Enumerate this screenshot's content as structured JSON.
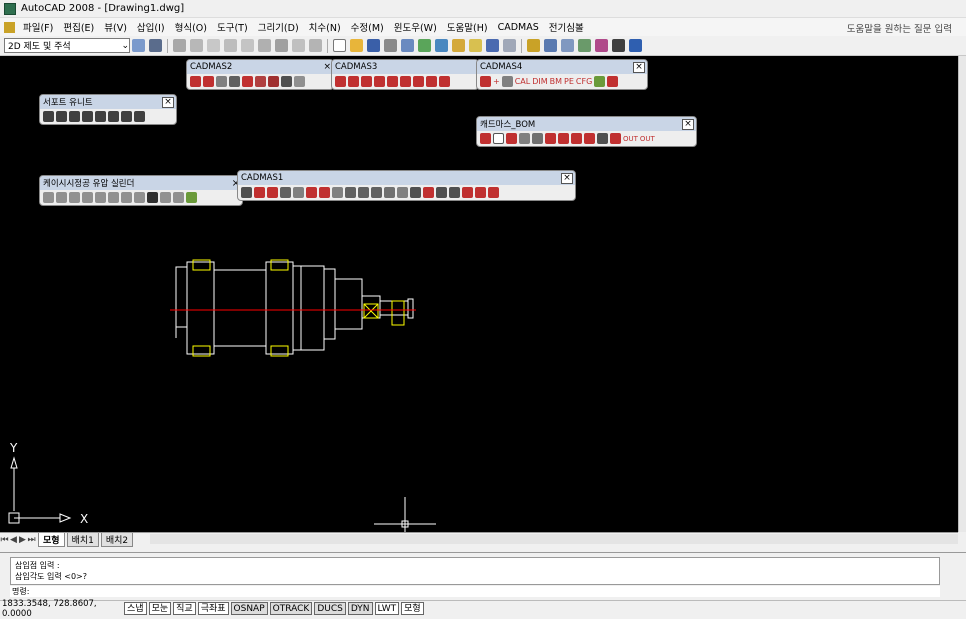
{
  "window": {
    "title": "AutoCAD 2008 - [Drawing1.dwg]"
  },
  "menu": {
    "items": [
      "파일(F)",
      "편집(E)",
      "뷰(V)",
      "삽입(I)",
      "형식(O)",
      "도구(T)",
      "그리기(D)",
      "치수(N)",
      "수정(M)",
      "윈도우(W)",
      "도움말(H)",
      "CADMAS",
      "전기심볼"
    ],
    "help_placeholder": "도움말을 원하는 질문 입력"
  },
  "toolbar": {
    "workspace": "2D 제도 및 주석"
  },
  "palettes": {
    "cadmas2": {
      "title": "CADMAS2"
    },
    "cadmas3": {
      "title": "CADMAS3"
    },
    "cadmas4": {
      "title": "CADMAS4",
      "labels": [
        "CAL",
        "DIM",
        "BM",
        "PE",
        "CFG"
      ]
    },
    "support": {
      "title": "서포트 유니트"
    },
    "bom": {
      "title": "캐드마스_BOM",
      "labels": [
        "OUT",
        "OUT"
      ]
    },
    "cylinder": {
      "title": "케이시시정공 유압 실린더"
    },
    "cadmas1": {
      "title": "CADMAS1"
    }
  },
  "ucs": {
    "x_label": "X",
    "y_label": "Y"
  },
  "tabs": {
    "model": "모형",
    "layout1": "배치1",
    "layout2": "배치2"
  },
  "command": {
    "line1": "삽입점 입력 :",
    "line2": "삽입각도 입력 <0>?",
    "prompt": "명령:"
  },
  "status": {
    "coords": "1833.3548, 728.8607, 0.0000",
    "buttons": [
      "스냅",
      "모눈",
      "직교",
      "극좌표",
      "OSNAP",
      "OTRACK",
      "DUCS",
      "DYN",
      "LWT",
      "모형"
    ]
  },
  "colors": {
    "canvas": "#000000",
    "palette_header": "#c9d5e6",
    "drawing_white": "#ffffff",
    "drawing_yellow": "#ffff00",
    "drawing_red": "#ff0000"
  }
}
